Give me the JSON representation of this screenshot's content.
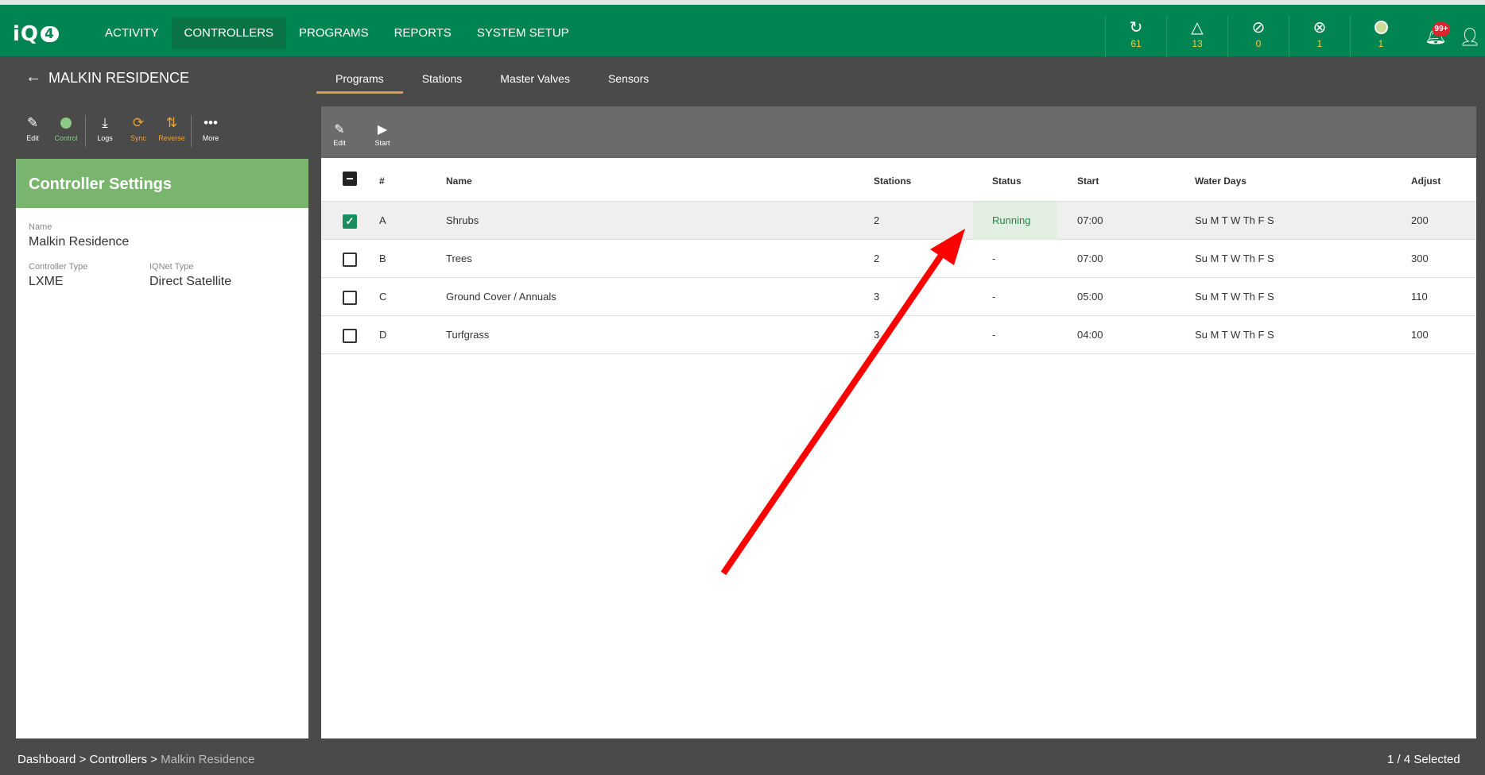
{
  "app": {
    "logo": "iQ",
    "logo_badge": "4"
  },
  "nav": [
    {
      "label": "ACTIVITY"
    },
    {
      "label": "CONTROLLERS",
      "active": true
    },
    {
      "label": "PROGRAMS"
    },
    {
      "label": "REPORTS"
    },
    {
      "label": "SYSTEM SETUP"
    }
  ],
  "stats": [
    {
      "icon": "sync-icon",
      "glyph": "↻",
      "value": "61"
    },
    {
      "icon": "alert-triangle-icon",
      "glyph": "△",
      "value": "13"
    },
    {
      "icon": "no-water-icon",
      "glyph": "⊘",
      "value": "0"
    },
    {
      "icon": "error-circle-icon",
      "glyph": "⊗",
      "value": "1"
    },
    {
      "icon": "status-dot-icon",
      "glyph": "",
      "value": "1"
    }
  ],
  "notifications": {
    "badge": "99+"
  },
  "controller": {
    "name": "MALKIN RESIDENCE"
  },
  "tabs": [
    {
      "label": "Programs",
      "active": true
    },
    {
      "label": "Stations"
    },
    {
      "label": "Master Valves"
    },
    {
      "label": "Sensors"
    }
  ],
  "left_tools": [
    {
      "icon": "edit-icon",
      "glyph": "✎",
      "label": "Edit"
    },
    {
      "icon": "control-dot-icon",
      "glyph": "",
      "label": "Control"
    },
    {
      "icon": "download-icon",
      "glyph": "⤓",
      "label": "Logs"
    },
    {
      "icon": "sync-icon",
      "glyph": "⟳",
      "label": "Sync"
    },
    {
      "icon": "reverse-icon",
      "glyph": "⇅",
      "label": "Reverse"
    },
    {
      "icon": "more-icon",
      "glyph": "•••",
      "label": "More"
    }
  ],
  "settings": {
    "title": "Controller Settings",
    "name_label": "Name",
    "name_value": "Malkin Residence",
    "type_label": "Controller Type",
    "type_value": "LXME",
    "iqnet_label": "IQNet Type",
    "iqnet_value": "Direct Satellite"
  },
  "right_tools": [
    {
      "icon": "edit-icon",
      "glyph": "✎",
      "label": "Edit"
    },
    {
      "icon": "play-icon",
      "glyph": "▶",
      "label": "Start"
    }
  ],
  "table": {
    "headers": {
      "num": "#",
      "name": "Name",
      "stations": "Stations",
      "status": "Status",
      "start": "Start",
      "water_days": "Water Days",
      "adjust": "Adjust"
    },
    "rows": [
      {
        "num": "A",
        "name": "Shrubs",
        "stations": "2",
        "status": "Running",
        "start": "07:00",
        "water_days": "Su M T W Th F S",
        "adjust": "200",
        "checked": true
      },
      {
        "num": "B",
        "name": "Trees",
        "stations": "2",
        "status": "-",
        "start": "07:00",
        "water_days": "Su M T W Th F S",
        "adjust": "300",
        "checked": false
      },
      {
        "num": "C",
        "name": "Ground Cover / Annuals",
        "stations": "3",
        "status": "-",
        "start": "05:00",
        "water_days": "Su M T W Th F S",
        "adjust": "110",
        "checked": false
      },
      {
        "num": "D",
        "name": "Turfgrass",
        "stations": "3",
        "status": "-",
        "start": "04:00",
        "water_days": "Su M T W Th F S",
        "adjust": "100",
        "checked": false
      }
    ]
  },
  "footer": {
    "crumb_1": "Dashboard",
    "sep": ">",
    "crumb_2": "Controllers",
    "crumb_3": "Malkin Residence",
    "selection": "1 / 4 Selected"
  },
  "colors": {
    "brand": "#008452",
    "accent": "#7ab56e",
    "annotation": "#ff0000"
  }
}
